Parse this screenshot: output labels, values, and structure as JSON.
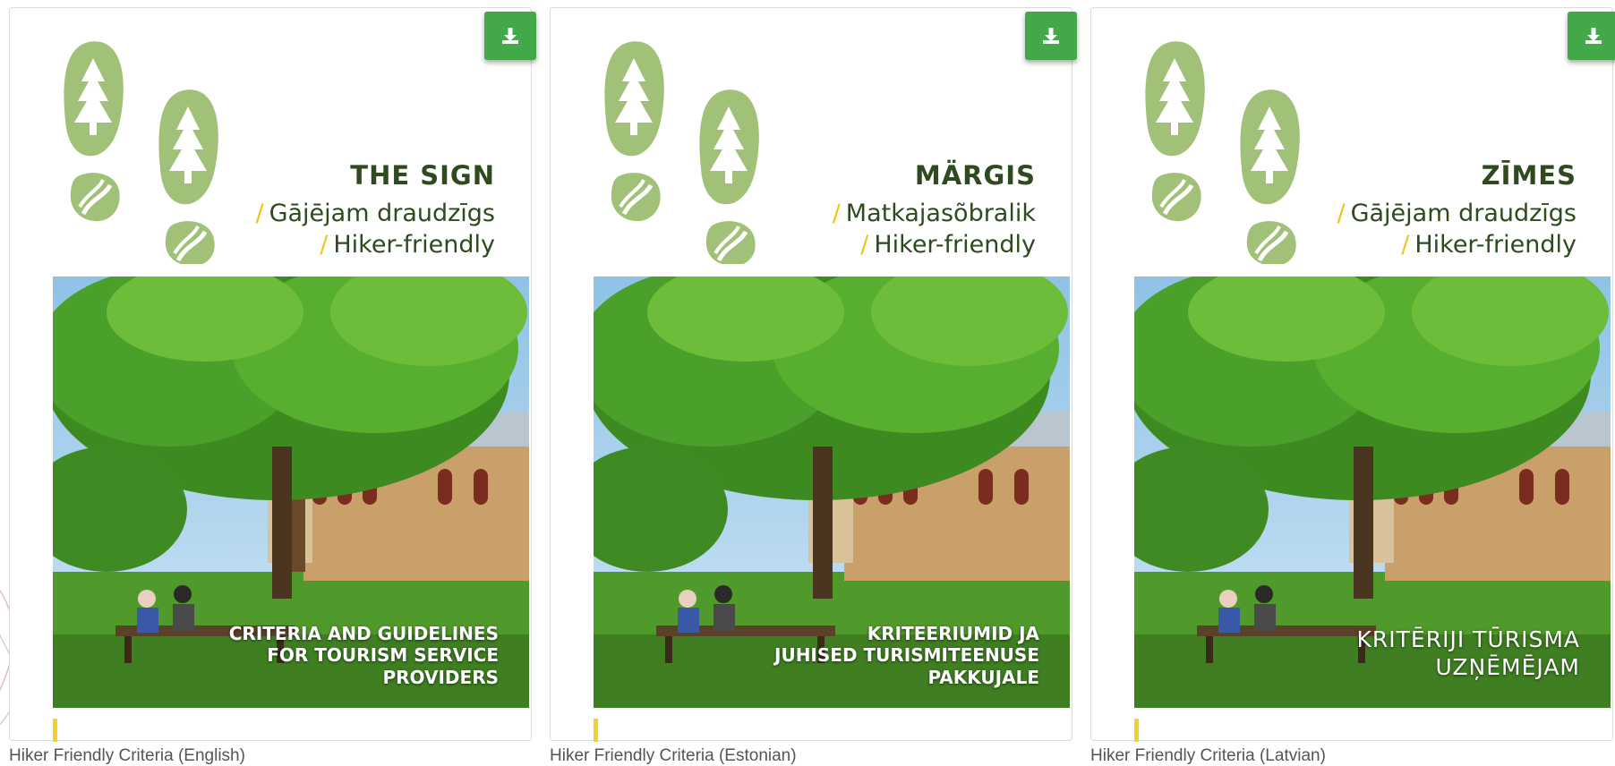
{
  "colors": {
    "download_button": "#42a84a",
    "footprint_green": "#a2c178",
    "title_dark_green": "#2f4a1f",
    "slash_yellow": "#f2c318",
    "caption_gray": "#555555"
  },
  "cards": [
    {
      "title": "THE SIGN",
      "subtitle_1": "Gājējam draudzīgs",
      "subtitle_2": "Hiker-friendly",
      "photo_caption": [
        "CRITERIA AND GUIDELINES",
        "FOR TOURISM SERVICE",
        "PROVIDERS"
      ],
      "label": "Hiker Friendly Criteria (English)",
      "download_icon": "download-icon"
    },
    {
      "title": "MÄRGIS",
      "subtitle_1": "Matkajasõbralik",
      "subtitle_2": "Hiker-friendly",
      "photo_caption": [
        "KRITEERIUMID JA",
        "JUHISED TURISMITEENUSE",
        "PAKKUJALE"
      ],
      "label": "Hiker Friendly Criteria (Estonian)",
      "download_icon": "download-icon"
    },
    {
      "title": "ZĪMES",
      "subtitle_1": "Gājējam draudzīgs",
      "subtitle_2": "Hiker-friendly",
      "photo_caption": [
        "KRITĒRIJI TŪRISMA",
        "UZŅĒMĒJAM"
      ],
      "label": "Hiker Friendly Criteria (Latvian)",
      "download_icon": "download-icon"
    }
  ]
}
